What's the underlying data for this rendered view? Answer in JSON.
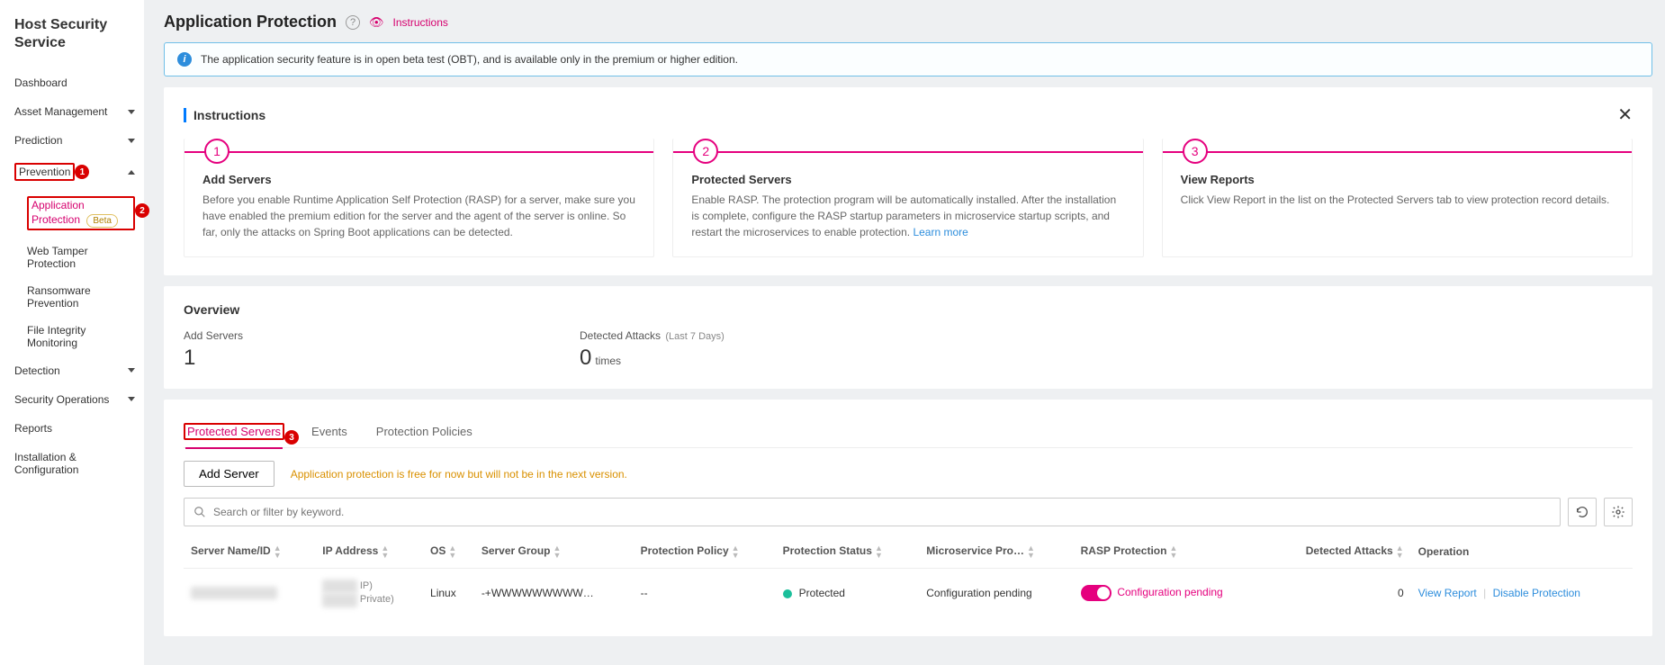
{
  "sidebar": {
    "title": "Host Security Service",
    "items": [
      {
        "label": "Dashboard"
      },
      {
        "label": "Asset Management"
      },
      {
        "label": "Prediction"
      },
      {
        "label": "Prevention"
      },
      {
        "label": "Detection"
      },
      {
        "label": "Security Operations"
      },
      {
        "label": "Reports"
      },
      {
        "label": "Installation & Configuration"
      }
    ],
    "prevention_sub": [
      {
        "label": "Application Protection",
        "badge": "Beta"
      },
      {
        "label": "Web Tamper Protection"
      },
      {
        "label": "Ransomware Prevention"
      },
      {
        "label": "File Integrity Monitoring"
      }
    ]
  },
  "header": {
    "title": "Application Protection",
    "instructions_link": "Instructions"
  },
  "info_bar": {
    "text": "The application security feature is in open beta test (OBT), and is available only in the premium or higher edition."
  },
  "instructions": {
    "heading": "Instructions",
    "steps": [
      {
        "num": "1",
        "title": "Add Servers",
        "desc": "Before you enable Runtime Application Self Protection (RASP) for a server, make sure you have enabled the premium edition for the server and the agent of the server is online. So far, only the attacks on Spring Boot applications can be detected."
      },
      {
        "num": "2",
        "title": "Protected Servers",
        "desc": "Enable RASP. The protection program will be automatically installed. After the installation is complete, configure the RASP startup parameters in microservice startup scripts, and restart the microservices to enable protection.",
        "learn": "Learn more"
      },
      {
        "num": "3",
        "title": "View Reports",
        "desc": "Click View Report in the list on the Protected Servers tab to view protection record details."
      }
    ]
  },
  "overview": {
    "heading": "Overview",
    "add_servers_label": "Add Servers",
    "add_servers_value": "1",
    "detected_label": "Detected Attacks",
    "detected_sub": "(Last 7 Days)",
    "detected_value": "0",
    "detected_suffix": "times"
  },
  "tabs": {
    "protected": "Protected Servers",
    "events": "Events",
    "policies": "Protection Policies"
  },
  "toolbar": {
    "add_server": "Add Server",
    "note": "Application protection is free for now but will not be in the next version.",
    "search_placeholder": "Search or filter by keyword."
  },
  "table": {
    "cols": {
      "name": "Server Name/ID",
      "ip": "IP Address",
      "os": "OS",
      "group": "Server Group",
      "policy": "Protection Policy",
      "status": "Protection Status",
      "micro": "Microservice Pro…",
      "rasp": "RASP Protection",
      "attacks": "Detected Attacks",
      "op": "Operation"
    },
    "row": {
      "name_blur": "xxxxxxxxxxxxxxxx",
      "ip_line1_blur": "xxxxxxx",
      "ip_line1_suffix": "IP)",
      "ip_line2_blur": "xxxxxxx",
      "ip_line2_suffix": "Private)",
      "os": "Linux",
      "group": "-+WWWWWWWWW…",
      "policy": "--",
      "status": "Protected",
      "micro": "Configuration pending",
      "rasp_text": "Configuration pending",
      "attacks": "0",
      "op_view": "View Report",
      "op_disable": "Disable Protection"
    }
  }
}
